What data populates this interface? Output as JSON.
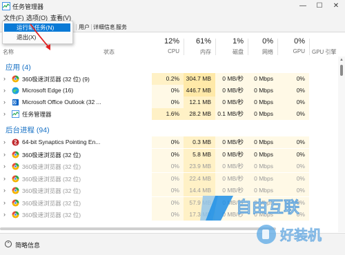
{
  "window": {
    "title": "任务管理器",
    "min": "—",
    "max": "☐",
    "close": "✕"
  },
  "menu": {
    "file": "文件(F)",
    "options": "选项(O)",
    "view": "查看(V)"
  },
  "file_menu": {
    "items": [
      "运行新任务(N)",
      "退出(X)"
    ],
    "highlighted": 0
  },
  "tabs": [
    "用户",
    "详细信息",
    "服务"
  ],
  "columns": {
    "name": "名称",
    "status": "状态",
    "cpu": {
      "pct": "12%",
      "label": "CPU"
    },
    "memory": {
      "pct": "61%",
      "label": "内存"
    },
    "disk": {
      "pct": "1%",
      "label": "磁盘"
    },
    "network": {
      "pct": "0%",
      "label": "网络"
    },
    "gpu": {
      "pct": "0%",
      "label": "GPU"
    },
    "gpu_engine": "GPU 引擎"
  },
  "groups": {
    "apps": "应用 (4)",
    "background": "后台进程 (94)"
  },
  "apps": [
    {
      "name": "360极速浏览器 (32 位) (9)",
      "cpu": "0.2%",
      "mem": "304.7 MB",
      "disk": "0 MB/秒",
      "net": "0 Mbps",
      "gpu": "0%",
      "icon": "360-browser-icon"
    },
    {
      "name": "Microsoft Edge (16)",
      "cpu": "0%",
      "mem": "446.7 MB",
      "disk": "0 MB/秒",
      "net": "0 Mbps",
      "gpu": "0%",
      "icon": "edge-icon"
    },
    {
      "name": "Microsoft Office Outlook (32 ...",
      "cpu": "0%",
      "mem": "12.1 MB",
      "disk": "0 MB/秒",
      "net": "0 Mbps",
      "gpu": "0%",
      "icon": "outlook-icon"
    },
    {
      "name": "任务管理器",
      "cpu": "1.6%",
      "mem": "28.2 MB",
      "disk": "0.1 MB/秒",
      "net": "0 Mbps",
      "gpu": "0%",
      "icon": "task-manager-icon"
    }
  ],
  "background": [
    {
      "name": "64-bit Synaptics Pointing En...",
      "cpu": "0%",
      "mem": "0.3 MB",
      "disk": "0 MB/秒",
      "net": "0 Mbps",
      "gpu": "0%",
      "icon": "synaptics-icon"
    },
    {
      "name": "360极速浏览器 (32 位)",
      "cpu": "0%",
      "mem": "5.8 MB",
      "disk": "0 MB/秒",
      "net": "0 Mbps",
      "gpu": "0%",
      "icon": "360-browser-icon"
    },
    {
      "name": "360极速浏览器 (32 位)",
      "cpu": "0%",
      "mem": "23.9 MB",
      "disk": "0 MB/秒",
      "net": "0 Mbps",
      "gpu": "0%",
      "icon": "360-browser-icon"
    },
    {
      "name": "360极速浏览器 (32 位)",
      "cpu": "0%",
      "mem": "22.4 MB",
      "disk": "0 MB/秒",
      "net": "0 Mbps",
      "gpu": "0%",
      "icon": "360-browser-icon"
    },
    {
      "name": "360极速浏览器 (32 位)",
      "cpu": "0%",
      "mem": "14.4 MB",
      "disk": "0 MB/秒",
      "net": "0 Mbps",
      "gpu": "0%",
      "icon": "360-browser-icon"
    },
    {
      "name": "360极速浏览器 (32 位)",
      "cpu": "0%",
      "mem": "57.9 MB",
      "disk": "0 MB/秒",
      "net": "0 Mbps",
      "gpu": "0%",
      "icon": "360-browser-icon"
    },
    {
      "name": "360极速浏览器 (32 位)",
      "cpu": "0%",
      "mem": "17.3 MB",
      "disk": "0 MB/秒",
      "net": "0 Mbps",
      "gpu": "0%",
      "icon": "360-browser-icon"
    }
  ],
  "footer": {
    "label": "简略信息"
  },
  "watermarks": {
    "center": "自由互联",
    "corner": "好装机"
  },
  "colors": {
    "accent": "#0a7ad6",
    "group": "#1670c4",
    "cell_light": "#fff9e6",
    "cell_mid": "#fff1c6",
    "cell_strong": "#ffe9a8",
    "arrow": "#e02020"
  }
}
